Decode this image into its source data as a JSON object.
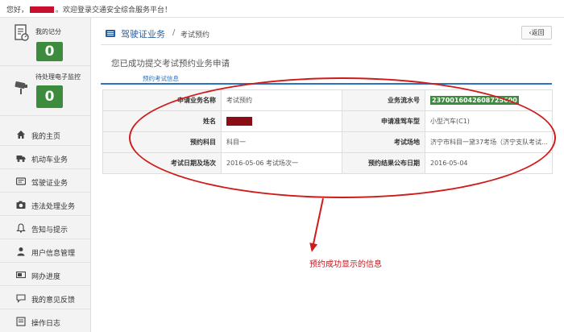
{
  "header": {
    "greeting_prefix": "您好，",
    "greeting_suffix": "。欢迎登录交通安全综合服务平台！"
  },
  "sidebar": {
    "score_label": "我的记分",
    "score_value": "0",
    "violations_label": "待处理电子监控",
    "violations_value": "0",
    "items": [
      {
        "label": "我的主页",
        "icon": "home-icon"
      },
      {
        "label": "机动车业务",
        "icon": "truck-icon"
      },
      {
        "label": "驾驶证业务",
        "icon": "id-card-icon"
      },
      {
        "label": "违法处理业务",
        "icon": "camera-icon"
      },
      {
        "label": "告知与提示",
        "icon": "bell-icon"
      },
      {
        "label": "用户信息管理",
        "icon": "user-icon"
      },
      {
        "label": "网办进度",
        "icon": "progress-icon"
      },
      {
        "label": "我的意见反馈",
        "icon": "feedback-icon"
      },
      {
        "label": "操作日志",
        "icon": "log-icon"
      }
    ]
  },
  "breadcrumb": {
    "main": "驾驶证业务",
    "separator": "/",
    "sub": "考试预约",
    "back_label": "‹返回"
  },
  "content": {
    "success_title": "您已成功提交考试预约业务申请",
    "tab_label": "预约考试信息",
    "rows": [
      {
        "l1": "申请业务名称",
        "v1": "考试预约",
        "l2": "业务流水号",
        "v2": "2370016042608725600"
      },
      {
        "l1": "姓名",
        "v1": "",
        "l2": "申请准驾车型",
        "v2": "小型汽车(C1)"
      },
      {
        "l1": "预约科目",
        "v1": "科目一",
        "l2": "考试场地",
        "v2": "济宁市科目一黛37考场（济宁支队考试..."
      },
      {
        "l1": "考试日期及场次",
        "v1": "2016-05-06 考试场次一",
        "l2": "预约结果公布日期",
        "v2": "2016-05-04"
      }
    ]
  },
  "annotation": {
    "text": "预约成功显示的信息"
  },
  "colors": {
    "accent": "#2b5d9c",
    "score_green": "#3d8b3d",
    "annotation_red": "#d11a1a"
  }
}
